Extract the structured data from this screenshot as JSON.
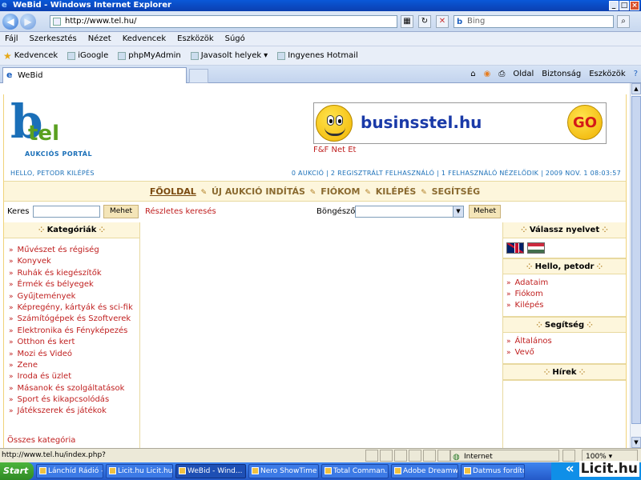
{
  "window": {
    "title": "WeBid - Windows Internet Explorer",
    "url": "http://www.tel.hu/",
    "search_placeholder": "Bing"
  },
  "menubar": [
    "Fájl",
    "Szerkesztés",
    "Nézet",
    "Kedvencek",
    "Eszközök",
    "Súgó"
  ],
  "favbar": [
    "Kedvencek",
    "iGoogle",
    "phpMyAdmin",
    "Javasolt helyek",
    "Ingyenes Hotmail"
  ],
  "tab": {
    "title": "WeBid"
  },
  "commandbar": [
    "Oldal",
    "Biztonság",
    "Eszközök"
  ],
  "site": {
    "logo": {
      "letter": "b",
      "word": "tel",
      "subtitle": "AUKCIÓS PORTÁL"
    },
    "banner": {
      "text": "businsstel.hu",
      "go": "GO",
      "caption": "F&F Net Et"
    },
    "user_line": "HELLO, PETODR KILÉPÉS",
    "stats_line": "0 AUKCIÓ | 2 REGISZTRÁLT FELHASZNÁLÓ | 1 FELHASZNÁLÓ NÉZELŐDIK | 2009 NOV. 1 08:03:57",
    "nav": [
      "FŐOLDAL",
      "ÚJ AUKCIÓ INDÍTÁS",
      "FIÓKOM",
      "KILÉPÉS",
      "SEGÍTSÉG"
    ],
    "search": {
      "label": "Keres",
      "button": "Mehet",
      "advanced": "Részletes keresés",
      "browse_label": "Böngésző",
      "browse_button": "Mehet"
    },
    "categories": {
      "title": "Kategóriák",
      "items": [
        "Művészet és régiség",
        "Konyvek",
        "Ruhák és kiegészítők",
        "Érmék és bélyegek",
        "Gyűjtemények",
        "Képregény, kártyák és sci-fik",
        "Számítógépek és Szoftverek",
        "Elektronika és Fényképezés",
        "Otthon és kert",
        "Mozi és Videó",
        "Zene",
        "Iroda és üzlet",
        "Másanok és szolgáltatások",
        "Sport és kikapcsolódás",
        "Játékszerek és játékok"
      ],
      "all": "Összes kategória"
    },
    "language": {
      "title": "Válassz nyelvet"
    },
    "hello": {
      "title": "Hello, petodr",
      "items": [
        "Adataim",
        "Fiókom",
        "Kilépés"
      ]
    },
    "help": {
      "title": "Segítség",
      "items": [
        "Általános",
        "Vevő"
      ]
    },
    "news": {
      "title": "Hírek"
    }
  },
  "statusbar": {
    "text": "http://www.tel.hu/index.php?",
    "zone": "Internet",
    "zoom": "100%"
  },
  "taskbar": {
    "start": "Start",
    "tasks": [
      "Lánchíd Rádió -...",
      "Licit.hu Licit.hu...",
      "WeBid - Wind...",
      "Nero ShowTime",
      "Total Comman...",
      "Adobe Dreamw...",
      "Datmus fordító"
    ],
    "active_task": 2,
    "watermark": "Licit.hu"
  }
}
